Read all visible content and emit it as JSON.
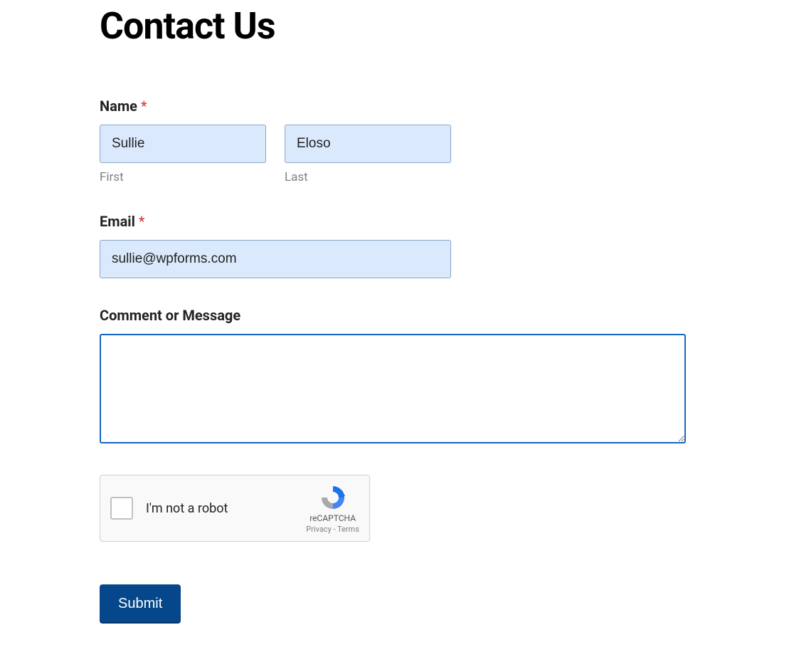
{
  "page": {
    "title": "Contact Us"
  },
  "form": {
    "name": {
      "label": "Name",
      "required_mark": "*",
      "first": {
        "value": "Sullie",
        "sublabel": "First"
      },
      "last": {
        "value": "Eloso",
        "sublabel": "Last"
      }
    },
    "email": {
      "label": "Email",
      "required_mark": "*",
      "value": "sullie@wpforms.com"
    },
    "message": {
      "label": "Comment or Message",
      "value": ""
    },
    "recaptcha": {
      "label": "I'm not a robot",
      "brand": "reCAPTCHA",
      "privacy": "Privacy",
      "separator": " - ",
      "terms": "Terms"
    },
    "submit_label": "Submit"
  }
}
